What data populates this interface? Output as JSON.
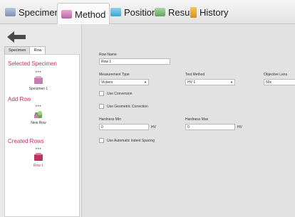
{
  "tabs": [
    {
      "label": "Specimen",
      "active": false,
      "icon": "specimen-icon"
    },
    {
      "label": "Method",
      "active": true,
      "icon": "method-icon"
    },
    {
      "label": "Position",
      "active": false,
      "icon": "position-icon"
    },
    {
      "label": "Result",
      "active": false,
      "icon": "result-icon"
    },
    {
      "label": "History",
      "active": false,
      "icon": "history-icon"
    }
  ],
  "left": {
    "subtabs": [
      "Specimen",
      "Row"
    ],
    "active_subtab": "Row",
    "selected_specimen": {
      "heading": "Selected Specimen",
      "stars": "***",
      "label": "Specimen 1"
    },
    "add_row": {
      "heading": "Add Row",
      "stars": "***",
      "label": "New Row"
    },
    "created_rows": {
      "heading": "Created Rows",
      "stars": "***",
      "label": "Row 1"
    }
  },
  "form": {
    "row_name": {
      "label": "Row Name",
      "value": "Row 1"
    },
    "measurement_type": {
      "label": "Measurement Type",
      "value": "Vickers"
    },
    "test_method": {
      "label": "Test Method",
      "value": "HV 1"
    },
    "objective_lens": {
      "label": "Objective Lens",
      "value": "50x"
    },
    "use_conversion": {
      "label": "Use Conversion",
      "checked": false
    },
    "use_geometric_correction": {
      "label": "Use Geometric Correction",
      "checked": false
    },
    "hardness_min": {
      "label": "Hardness Min",
      "value": "0",
      "unit": "HV"
    },
    "hardness_max": {
      "label": "Hardness Max",
      "value": "0",
      "unit": "HV"
    },
    "use_automatic_indent_spacing": {
      "label": "Use Automatic Indent Spacing",
      "checked": false
    }
  },
  "colors": {
    "accent": "#c0305d",
    "panel": "#ffffff",
    "background": "#e2e2e2"
  }
}
